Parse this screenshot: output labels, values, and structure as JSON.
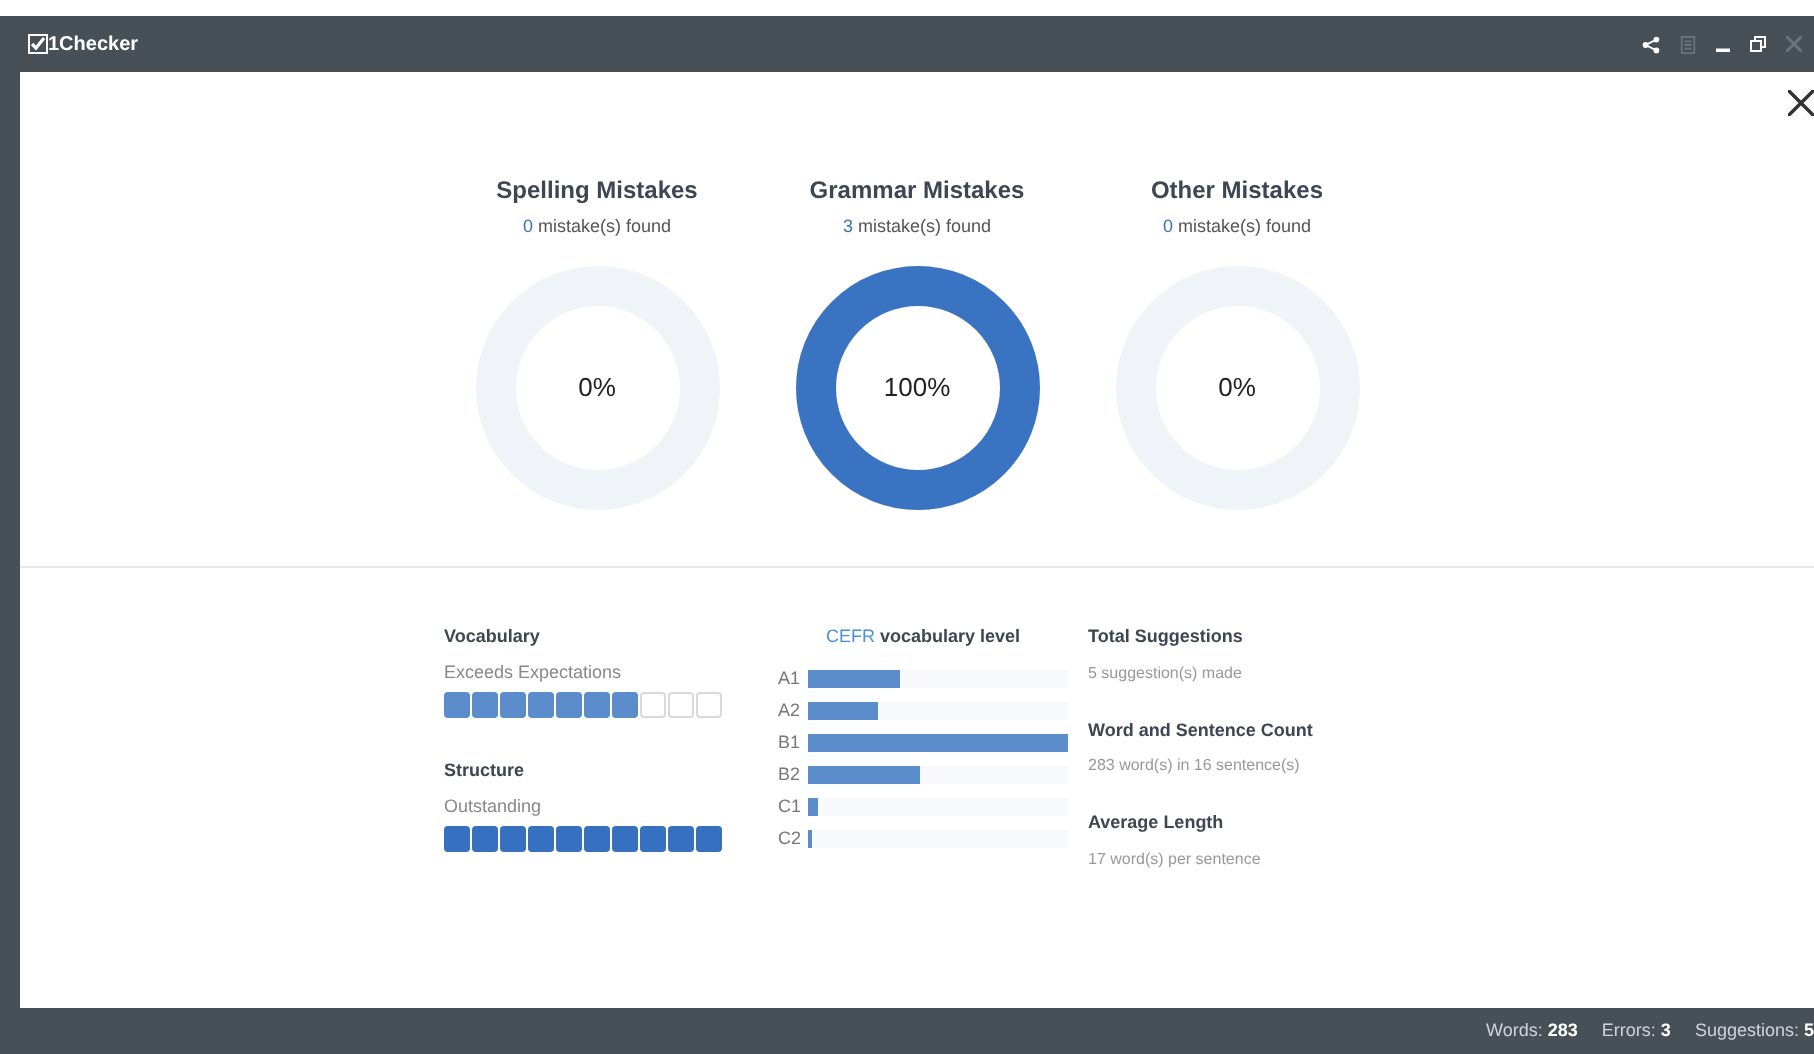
{
  "window": {
    "title": "1Checker"
  },
  "summaries": [
    {
      "title": "Spelling Mistakes",
      "count": "0",
      "text": "mistake(s) found",
      "percent": "0%"
    },
    {
      "title": "Grammar Mistakes",
      "count": "3",
      "text": "mistake(s) found",
      "percent": "100%"
    },
    {
      "title": "Other Mistakes",
      "count": "0",
      "text": "mistake(s) found",
      "percent": "0%"
    }
  ],
  "ratings": [
    {
      "title": "Vocabulary",
      "grade": "Exceeds Expectations",
      "stars": 7
    },
    {
      "title": "Structure",
      "grade": "Outstanding",
      "stars": 10
    }
  ],
  "cefr": {
    "title_prefix": "CEFR",
    "title": "vocabulary level",
    "bars": [
      {
        "label": "A1",
        "level": 0.35
      },
      {
        "label": "A2",
        "level": 0.27
      },
      {
        "label": "B1",
        "level": 1
      },
      {
        "label": "B2",
        "level": 0.43
      },
      {
        "label": "C1",
        "level": 0.04
      },
      {
        "label": "C2",
        "level": 0.015
      }
    ]
  },
  "stats": [
    {
      "title": "Total Suggestions",
      "text": "5 suggestion(s) made"
    },
    {
      "title": "Word and Sentence Count",
      "text": "283 word(s) in 16 sentence(s)"
    },
    {
      "title": "Average Length",
      "text": "17 word(s) per sentence"
    }
  ],
  "status_bar": [
    {
      "label": "Words:",
      "value": "283"
    },
    {
      "label": "Errors:",
      "value": "3"
    },
    {
      "label": "Suggestions:",
      "value": "5"
    }
  ]
}
